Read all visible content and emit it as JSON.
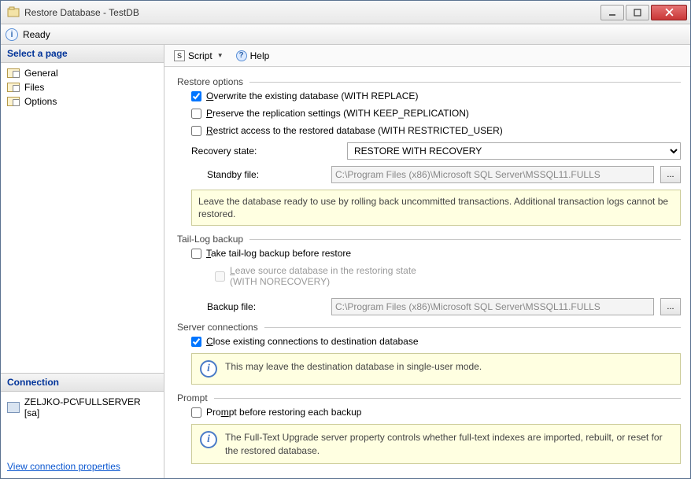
{
  "window": {
    "title": "Restore Database - TestDB"
  },
  "status": {
    "text": "Ready"
  },
  "sidebar": {
    "header": "Select a page",
    "items": [
      "General",
      "Files",
      "Options"
    ],
    "connection_header": "Connection",
    "connection": "ZELJKO-PC\\FULLSERVER [sa]",
    "link": "View connection properties"
  },
  "toolbar": {
    "script": "Script",
    "help": "Help"
  },
  "main": {
    "restore_options": {
      "title": "Restore options",
      "overwrite": {
        "u": "O",
        "rest": "verwrite the existing database (WITH REPLACE)"
      },
      "preserve": {
        "u": "P",
        "rest": "reserve the replication settings (WITH KEEP_REPLICATION)"
      },
      "restrict": {
        "u": "R",
        "rest": "estrict access to the restored database (WITH RESTRICTED_USER)"
      },
      "recovery_label": "Recovery state:",
      "recovery_value": "RESTORE WITH RECOVERY",
      "standby": {
        "u": "S",
        "rest": "tandby file:"
      },
      "standby_path": "C:\\Program Files (x86)\\Microsoft SQL Server\\MSSQL11.FULLS",
      "info": "Leave the database ready to use by rolling back uncommitted transactions. Additional transaction logs cannot be restored."
    },
    "tail_log": {
      "title": "Tail-Log backup",
      "take": {
        "u": "T",
        "rest": "ake tail-log backup before restore"
      },
      "leave": {
        "u": "L",
        "line1": "eave source database in the restoring state",
        "line2": "(WITH NORECOVERY)"
      },
      "backup": {
        "u": "B",
        "rest": "ackup file:"
      },
      "backup_path": "C:\\Program Files (x86)\\Microsoft SQL Server\\MSSQL11.FULLS"
    },
    "server_conn": {
      "title": "Server connections",
      "close": {
        "u": "C",
        "rest": "lose existing connections to destination database"
      },
      "info": "This may leave the destination database in single-user mode."
    },
    "prompt": {
      "title": "Prompt",
      "prompt": {
        "pre": "Pro",
        "u": "m",
        "rest": "pt before restoring each backup"
      },
      "info": "The Full-Text Upgrade server property controls whether full-text indexes are imported, rebuilt, or reset for the restored database."
    }
  }
}
